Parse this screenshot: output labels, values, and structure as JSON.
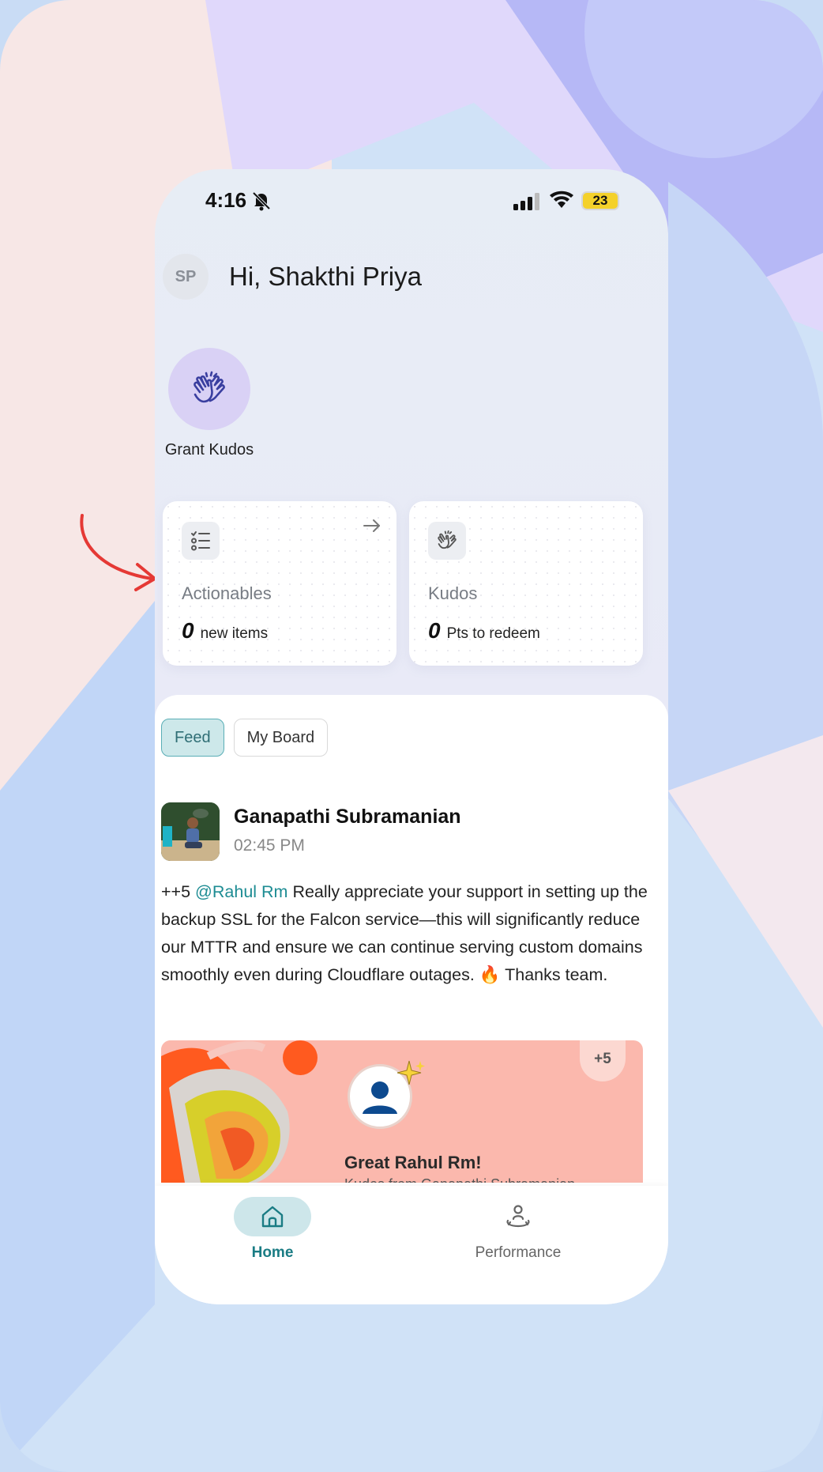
{
  "status_bar": {
    "time": "4:16",
    "battery": "23",
    "icons": [
      "bell-off-icon",
      "signal-icon",
      "wifi-icon",
      "battery-icon"
    ]
  },
  "header": {
    "avatar_initials": "SP",
    "greeting": "Hi, Shakthi Priya"
  },
  "quick_actions": {
    "grant_kudos_label": "Grant Kudos",
    "grant_kudos_icon": "clapping-hands-icon"
  },
  "cards": {
    "actionables": {
      "title": "Actionables",
      "value": "0",
      "subtitle": "new items",
      "icon": "checklist-icon"
    },
    "kudos": {
      "title": "Kudos",
      "value": "0",
      "subtitle": "Pts to redeem",
      "icon": "clapping-hands-icon"
    }
  },
  "tabs": [
    {
      "label": "Feed",
      "active": true
    },
    {
      "label": "My Board",
      "active": false
    }
  ],
  "post": {
    "author": "Ganapathi Subramanian",
    "time": "02:45 PM",
    "body_prefix": "++5 ",
    "mention": "@Rahul Rm",
    "body_text": " Really appreciate your support in setting up the backup SSL for the Falcon service—this will significantly reduce our MTTR and ensure we can continue serving custom domains smoothly even during Cloudflare outages. 🔥 Thanks team.",
    "kudos_card": {
      "points_badge": "+5",
      "title": "Great Rahul Rm!",
      "subtitle": "Kudos from Ganapathi Subramanian"
    }
  },
  "bottom_nav": [
    {
      "label": "Home",
      "icon": "home-icon",
      "active": true
    },
    {
      "label": "Performance",
      "icon": "performance-icon",
      "active": false
    }
  ],
  "colors": {
    "accent": "#1a7c84",
    "tab_active_bg": "#cde8ea",
    "kudos_banner": "#fbb8ad",
    "annotation_arrow": "#e53935"
  }
}
